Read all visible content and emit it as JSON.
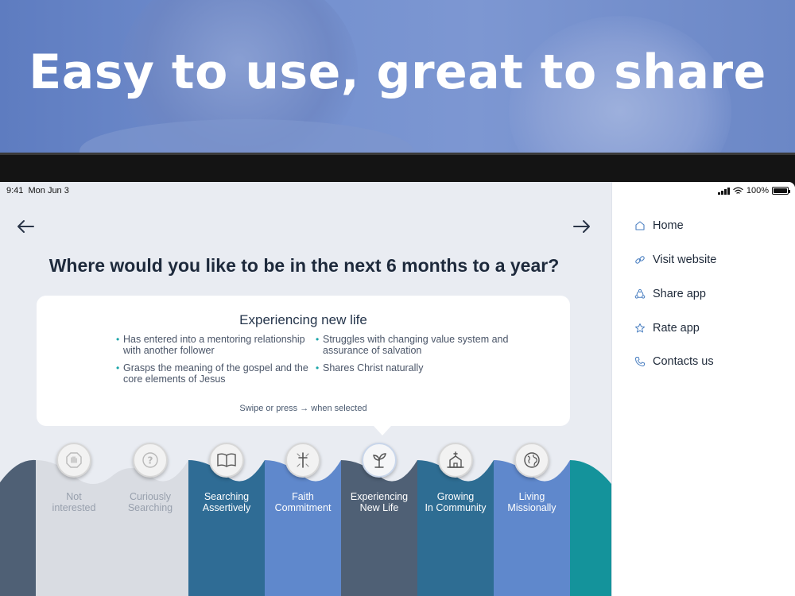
{
  "hero": {
    "title": "Easy to use, great to share"
  },
  "status_bar": {
    "time": "9:41",
    "date": "Mon Jun 3",
    "battery": "100%"
  },
  "question": "Where would you like to be in the next 6 months to a year?",
  "card": {
    "title": "Experiencing new life",
    "bullets": [
      "Has entered into a mentoring relationship with another follower",
      "Struggles with changing value system and assurance of salvation",
      "Grasps the meaning of the gospel and the core elements of Jesus",
      "Shares Christ naturally"
    ],
    "hint": "Swipe or press → when selected"
  },
  "stages": [
    {
      "label": "Not\ninterested",
      "icon": "hand-stop-icon",
      "color": "#d9dce2"
    },
    {
      "label": "Curiously\nSearching",
      "icon": "question-icon",
      "color": "#d9dce2"
    },
    {
      "label": "Searching\nAssertively",
      "icon": "book-icon",
      "color": "#2f6c95"
    },
    {
      "label": "Faith\nCommitment",
      "icon": "cross-icon",
      "color": "#5f88cc"
    },
    {
      "label": "Experiencing\nNew Life",
      "icon": "sprout-icon",
      "color": "#4f6075"
    },
    {
      "label": "Growing\nIn Community",
      "icon": "church-icon",
      "color": "#2e6d93"
    },
    {
      "label": "Living\nMissionally",
      "icon": "globe-icon",
      "color": "#5f88cc"
    }
  ],
  "menu": {
    "items": [
      {
        "label": "Home",
        "icon": "home-icon"
      },
      {
        "label": "Visit website",
        "icon": "link-icon"
      },
      {
        "label": "Share app",
        "icon": "share-icon"
      },
      {
        "label": "Rate app",
        "icon": "star-icon"
      },
      {
        "label": "Contacts us",
        "icon": "phone-icon"
      }
    ]
  },
  "colors": {
    "accent": "#1aa5a8",
    "text_dark": "#1e2a3c",
    "menu_icon": "#4a7fc1"
  }
}
